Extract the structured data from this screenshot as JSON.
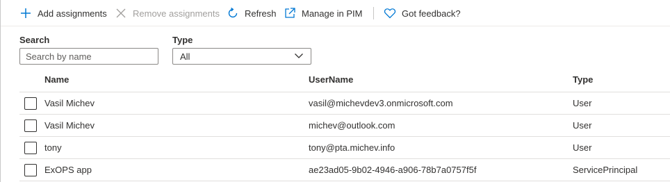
{
  "toolbar": {
    "add_label": "Add assignments",
    "remove_label": "Remove assignments",
    "refresh_label": "Refresh",
    "pim_label": "Manage in PIM",
    "feedback_label": "Got feedback?",
    "accent_color": "#0078d4",
    "disabled_color": "#a19f9d"
  },
  "filters": {
    "search_label": "Search",
    "search_placeholder": "Search by name",
    "type_label": "Type",
    "type_value": "All"
  },
  "table": {
    "headers": {
      "name": "Name",
      "username": "UserName",
      "type": "Type"
    },
    "rows": [
      {
        "name": "Vasil Michev",
        "username": "vasil@michevdev3.onmicrosoft.com",
        "type": "User"
      },
      {
        "name": "Vasil Michev",
        "username": "michev@outlook.com",
        "type": "User"
      },
      {
        "name": "tony",
        "username": "tony@pta.michev.info",
        "type": "User"
      },
      {
        "name": "ExOPS app",
        "username": "ae23ad05-9b02-4946-a906-78b7a0757f5f",
        "type": "ServicePrincipal"
      }
    ]
  }
}
